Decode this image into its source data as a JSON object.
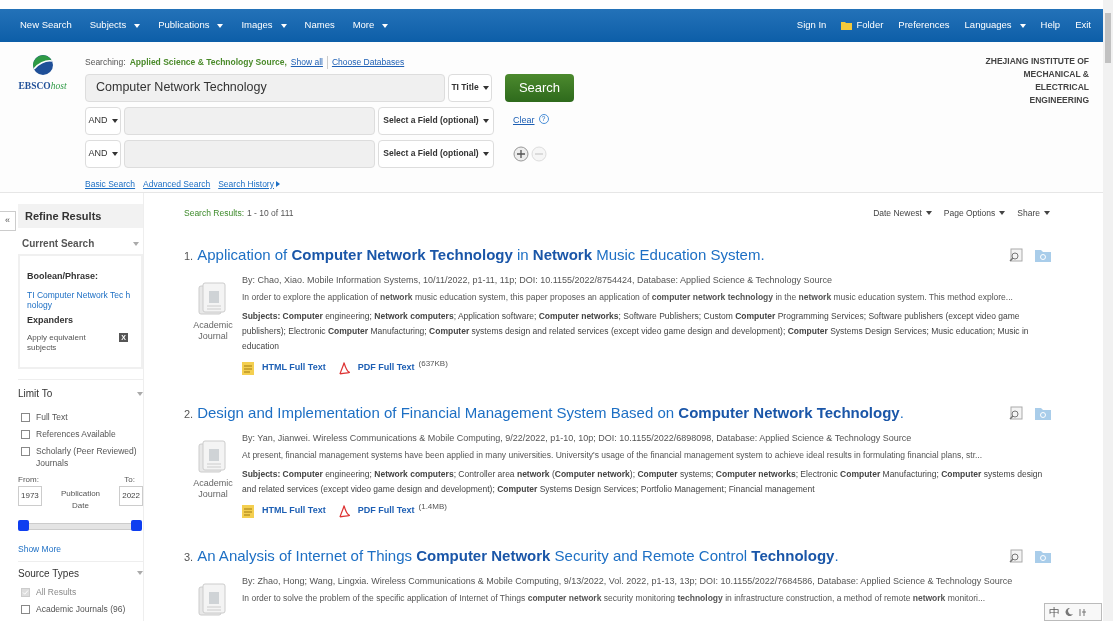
{
  "nav": {
    "left": [
      {
        "label": "New Search",
        "dropdown": false
      },
      {
        "label": "Subjects",
        "dropdown": true
      },
      {
        "label": "Publications",
        "dropdown": true
      },
      {
        "label": "Images",
        "dropdown": true
      },
      {
        "label": "Names",
        "dropdown": false
      },
      {
        "label": "More",
        "dropdown": true
      }
    ],
    "right": [
      {
        "label": "Sign In",
        "kind": "link"
      },
      {
        "label": "Folder",
        "kind": "folder"
      },
      {
        "label": "Preferences",
        "kind": "link"
      },
      {
        "label": "Languages",
        "kind": "dropdown"
      },
      {
        "label": "Help",
        "kind": "link"
      },
      {
        "label": "Exit",
        "kind": "link"
      }
    ]
  },
  "logo": {
    "text": "EBSCO",
    "suffix": "host"
  },
  "searching": {
    "label": "Searching:",
    "database": "Applied Science & Technology Source,",
    "show_all": "Show all",
    "choose": "Choose Databases"
  },
  "search_rows": [
    {
      "operator": null,
      "value": "Computer Network Technology",
      "field": "TI Title"
    },
    {
      "operator": "AND",
      "value": null,
      "field": "Select a Field (optional)"
    },
    {
      "operator": "AND",
      "value": null,
      "field": "Select a Field (optional)"
    }
  ],
  "search_button": "Search",
  "clear": "Clear",
  "help": "?",
  "search_links": [
    "Basic Search",
    "Advanced Search",
    "Search History"
  ],
  "institution": "ZHEJIANG INSTITUTE OF MECHANICAL & ELECTRICAL ENGINEERING",
  "sidebar": {
    "collapse": "«",
    "title": "Refine Results",
    "current_search": {
      "heading": "Current Search",
      "boolean_label": "Boolean/Phrase:",
      "query": "TI Computer Network Tec hnology",
      "expanders_label": "Expanders",
      "expander": "Apply equivalent subjects",
      "remove": "X"
    },
    "limit_to": {
      "heading": "Limit To",
      "options": [
        {
          "label": "Full Text",
          "checked": false,
          "disabled": false
        },
        {
          "label": "References Available",
          "checked": false,
          "disabled": false
        },
        {
          "label": "Scholarly (Peer Reviewed) Journals",
          "checked": false,
          "disabled": false
        }
      ],
      "from_label": "From:",
      "to_label": "To:",
      "from": "1973",
      "to": "2022",
      "date_label": "Publication Date",
      "handles": [
        {
          "level": 0
        },
        {
          "level": 1
        }
      ]
    },
    "show_more": "Show More",
    "source_types": {
      "heading": "Source Types",
      "options": [
        {
          "label": "All Results",
          "checked": true,
          "disabled": true
        },
        {
          "label": "Academic Journals (96)",
          "checked": false,
          "disabled": false
        }
      ]
    }
  },
  "results_header": {
    "label": "Search Results:",
    "range": "1 - 10 of 111",
    "menus": [
      "Date Newest",
      "Page Options",
      "Share"
    ]
  },
  "results": [
    {
      "number": "1.",
      "title": "Application of **Computer Network Technology** in **Network** Music Education System.",
      "byline": "By: Chao, Xiao. Mobile Information Systems, 10/11/2022, p1-11, 11p; DOI: 10.1155/2022/8754424, Database: Applied Science & Technology Source",
      "abstract": "In order to explore the application of **network** music education system, this paper proposes an application of **computer network technology** in the **network** music education system. This method explore...",
      "type": "Academic Journal",
      "subjects": "**Subjects: Computer** engineering; **Network computers**; Application software; **Computer networks**; Software Publishers; Custom **Computer** Programming Services; Software publishers (except video game publishers); Electronic **Computer** Manufacturing; **Computer** systems design and related services (except video game design and development); **Computer** Systems Design Services; Music education; Music in education",
      "html": "HTML Full Text",
      "pdf": "PDF Full Text",
      "size": "(637KB)"
    },
    {
      "number": "2.",
      "title": "Design and Implementation of Financial Management System Based on **Computer Network Technology**.",
      "byline": "By: Yan, Jianwei. Wireless Communications & Mobile Computing, 9/22/2022, p1-10, 10p; DOI: 10.1155/2022/6898098, Database: Applied Science & Technology Source",
      "abstract": "At present, financial management systems have been applied in many universities. University's usage of the financial management system to achieve ideal results in formulating financial plans, str...",
      "type": "Academic Journal",
      "subjects": "**Subjects: Computer** engineering; **Network computers**; Controller area **network** (**Computer network**); **Computer** systems; **Computer networks**; Electronic **Computer** Manufacturing; **Computer** systems design and related services (except video game design and development); **Computer** Systems Design Services; Portfolio Management; Financial management",
      "html": "HTML Full Text",
      "pdf": "PDF Full Text",
      "size": "(1.4MB)"
    },
    {
      "number": "3.",
      "title": "An Analysis of Internet of Things **Computer Network** Security and Remote Control **Technology**.",
      "byline": "By: Zhao, Hong; Wang, Lingxia. Wireless Communications & Mobile Computing, 9/13/2022, Vol. 2022, p1-13, 13p; DOI: 10.1155/2022/7684586, Database: Applied Science & Technology Source",
      "abstract": "In order to solve the problem of the specific application of Internet of Things **computer network** security monitoring **technology** in infrastructure construction, a method of remote **network** monitori..."
    }
  ],
  "ime_toolbar": "中"
}
